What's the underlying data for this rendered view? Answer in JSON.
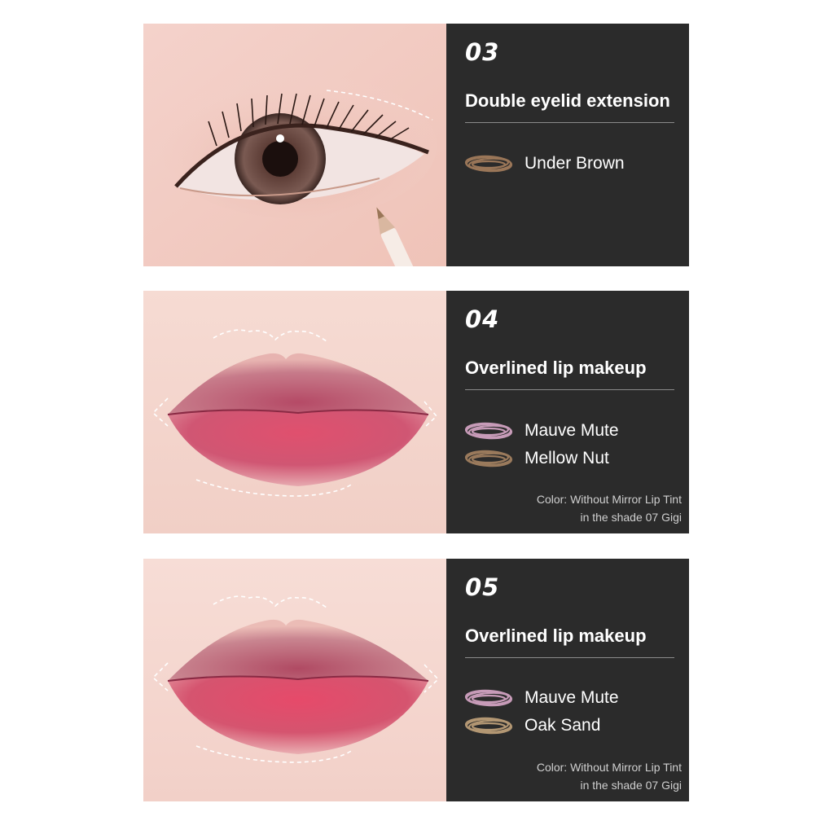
{
  "cards": [
    {
      "number": "03",
      "title": "Double eyelid extension",
      "shades": [
        {
          "label": "Under Brown",
          "color": "#9a7658"
        }
      ],
      "note_line1": "",
      "note_line2": ""
    },
    {
      "number": "04",
      "title": "Overlined lip makeup",
      "shades": [
        {
          "label": "Mauve Mute",
          "color": "#c79bb8"
        },
        {
          "label": "Mellow Nut",
          "color": "#9a7a5c"
        }
      ],
      "note_line1": "Color: Without Mirror Lip Tint",
      "note_line2": "in the shade 07 Gigi"
    },
    {
      "number": "05",
      "title": "Overlined lip makeup",
      "shades": [
        {
          "label": "Mauve Mute",
          "color": "#c79bb8"
        },
        {
          "label": "Oak Sand",
          "color": "#b39773"
        }
      ],
      "note_line1": "Color: Without Mirror Lip Tint",
      "note_line2": "in the shade 07 Gigi"
    }
  ],
  "colors": {
    "panel_bg": "#2b2b2b",
    "skin": "#f3cfc6",
    "lip": "#c94d6a"
  }
}
